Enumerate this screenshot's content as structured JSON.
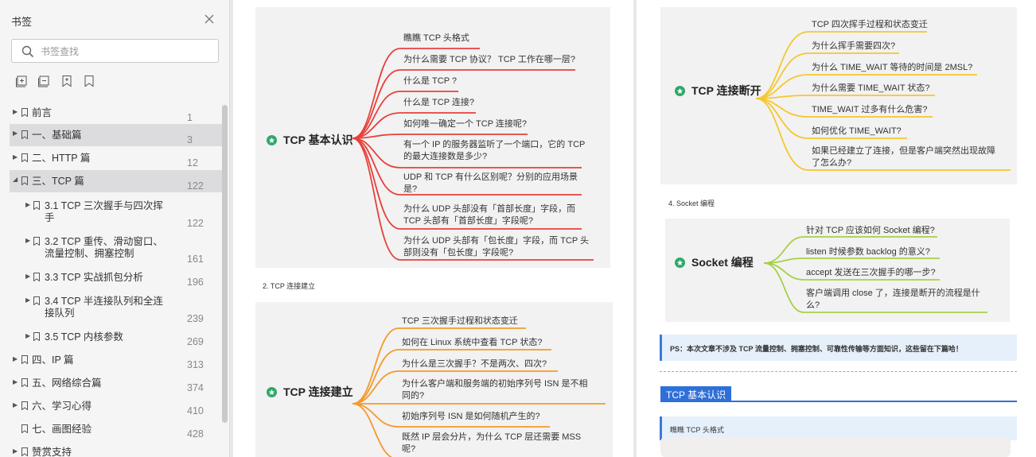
{
  "sidebar": {
    "title": "书签",
    "search_placeholder": "书签查找",
    "bookmarks": [
      {
        "label": "前言",
        "page": "1"
      },
      {
        "label": "一、基础篇",
        "page": "3"
      },
      {
        "label": "二、HTTP 篇",
        "page": "12"
      },
      {
        "label": "三、TCP 篇",
        "page": "122"
      },
      {
        "label_l1": "3.1 TCP 三次握手与四次挥",
        "label_l2": "手",
        "page": "122"
      },
      {
        "label_l1": "3.2 TCP 重传、滑动窗口、",
        "label_l2": "流量控制、拥塞控制",
        "page": "161"
      },
      {
        "label": "3.3  TCP 实战抓包分析",
        "page": "196"
      },
      {
        "label_l1": "3.4 TCP 半连接队列和全连",
        "label_l2": "接队列",
        "page": "239"
      },
      {
        "label": "3.5 TCP 内核参数",
        "page": "269"
      },
      {
        "label": "四、IP 篇",
        "page": "313"
      },
      {
        "label": "五、网络综合篇",
        "page": "374"
      },
      {
        "label": "六、学习心得",
        "page": "410"
      },
      {
        "label": "七、画图经验",
        "page": "428"
      },
      {
        "label": "赞赏支持",
        "page": ""
      }
    ]
  },
  "page1": {
    "mm1": {
      "center": "TCP 基本认识",
      "color": "#e8403b",
      "items": [
        [
          "瞧瞧 TCP 头格式"
        ],
        [
          "为什么需要 TCP 协议？ TCP 工作在哪一层?"
        ],
        [
          "什么是 TCP ?"
        ],
        [
          "什么是 TCP 连接?"
        ],
        [
          "如何唯一确定一个 TCP 连接呢?"
        ],
        [
          "有一个 IP 的服务器监听了一个端口，它的 TCP",
          "的最大连接数是多少?"
        ],
        [
          "UDP 和 TCP 有什么区别呢？分别的应用场景",
          "是?"
        ],
        [
          "为什么 UDP 头部没有「首部长度」字段，而",
          "TCP 头部有「首部长度」字段呢?"
        ],
        [
          "为什么 UDP 头部有「包长度」字段，而 TCP 头",
          "部则没有「包长度」字段呢?"
        ]
      ]
    },
    "caption": "2. TCP 连接建立",
    "mm2": {
      "center": "TCP 连接建立",
      "color": "#f39a2c",
      "items": [
        [
          "TCP 三次握手过程和状态变迁"
        ],
        [
          "如何在 Linux 系统中查看 TCP 状态?"
        ],
        [
          "为什么是三次握手？不是两次、四次?"
        ],
        [
          "为什么客户端和服务端的初始序列号 ISN 是不相",
          "同的?"
        ],
        [
          "初始序列号 ISN 是如何随机产生的?"
        ],
        [
          "既然 IP 层会分片，为什么 TCP 层还需要 MSS",
          "呢?"
        ]
      ]
    }
  },
  "page2": {
    "mm3": {
      "center": "TCP 连接断开",
      "color": "#f5c72f",
      "items": [
        [
          "TCP 四次挥手过程和状态变迁"
        ],
        [
          "为什么挥手需要四次?"
        ],
        [
          "为什么 TIME_WAIT 等待的时间是 2MSL?"
        ],
        [
          "为什么需要 TIME_WAIT 状态?"
        ],
        [
          "TIME_WAIT 过多有什么危害?"
        ],
        [
          "如何优化 TIME_WAIT?"
        ],
        [
          "如果已经建立了连接，但是客户端突然出现故障",
          "了怎么办?"
        ]
      ]
    },
    "caption": "4. Socket 编程",
    "mm4": {
      "center": "Socket 编程",
      "color": "#a6cf48",
      "items": [
        [
          "针对 TCP 应该如何 Socket 编程?"
        ],
        [
          "listen 时候参数 backlog 的意义?"
        ],
        [
          "accept 发送在三次握手的哪一步?"
        ],
        [
          "客户端调用 close 了，连接是断开的流程是什",
          "么?"
        ]
      ]
    },
    "ps": "PS：本次文章不涉及 TCP 流量控制、拥塞控制、可靠性传输等方面知识，这些留在下篇哈！",
    "section_title": "TCP 基本认识",
    "subsection": "瞧瞧 TCP 头格式"
  }
}
